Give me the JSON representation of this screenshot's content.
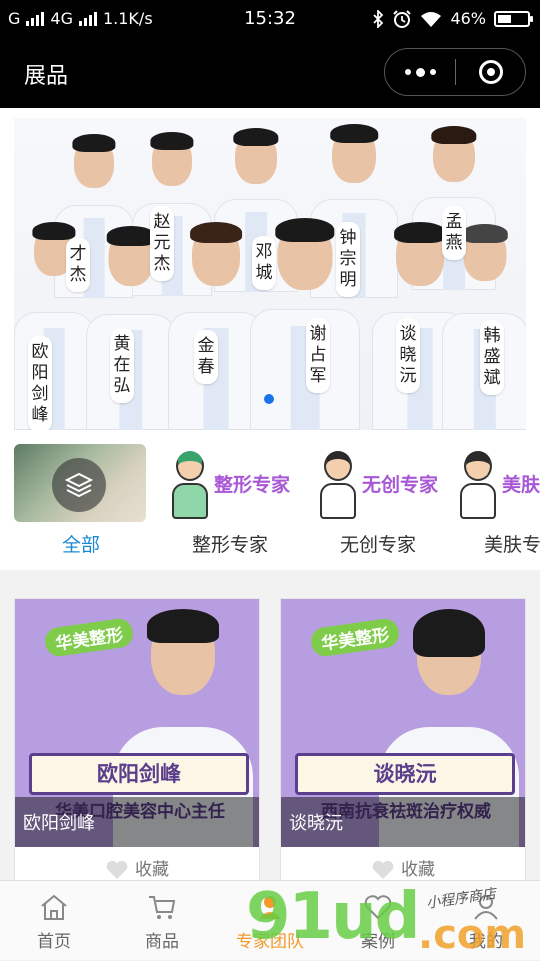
{
  "status_bar": {
    "carrier": "G",
    "network": "4G",
    "speed": "1.1K/s",
    "time": "15:32",
    "battery": "46%",
    "battery_level": 0.46
  },
  "header": {
    "title": "展品"
  },
  "banner": {
    "doctors": [
      "才杰",
      "赵元杰",
      "邓城",
      "钟宗明",
      "孟燕",
      "欧阳剑峰",
      "黄在弘",
      "金春",
      "谢占军",
      "谈晓沅",
      "韩盛斌"
    ],
    "slide_index": 1,
    "slide_count": 1
  },
  "categories": [
    {
      "label": "全部",
      "active": true
    },
    {
      "label": "整形专家",
      "art_text": "整形专家",
      "active": false
    },
    {
      "label": "无创专家",
      "art_text": "无创专家",
      "active": false
    },
    {
      "label": "美肤专",
      "art_text": "美肤",
      "active": false
    }
  ],
  "cards": [
    {
      "tag": "华美整形",
      "sign": "欧阳剑峰",
      "subtitle": "华美口腔美容中心主任",
      "name": "欧阳剑峰",
      "fav_label": "收藏"
    },
    {
      "tag": "华美整形",
      "sign": "谈晓沅",
      "subtitle": "西南抗衰祛斑治疗权威",
      "name": "谈晓沅",
      "fav_label": "收藏"
    }
  ],
  "tabbar": [
    {
      "label": "首页",
      "icon": "home-icon"
    },
    {
      "label": "商品",
      "icon": "cart-icon"
    },
    {
      "label": "专家团队",
      "icon": "team-icon",
      "active": true
    },
    {
      "label": "案例",
      "icon": "case-icon"
    },
    {
      "label": "我的",
      "icon": "user-icon"
    }
  ],
  "watermark": {
    "main": "91ud",
    "suffix": ".com",
    "caption": "小程序商店"
  },
  "colors": {
    "accent_blue": "#1a8ad4",
    "tab_active": "#f39a2b",
    "card_purple": "#b79ee0"
  }
}
